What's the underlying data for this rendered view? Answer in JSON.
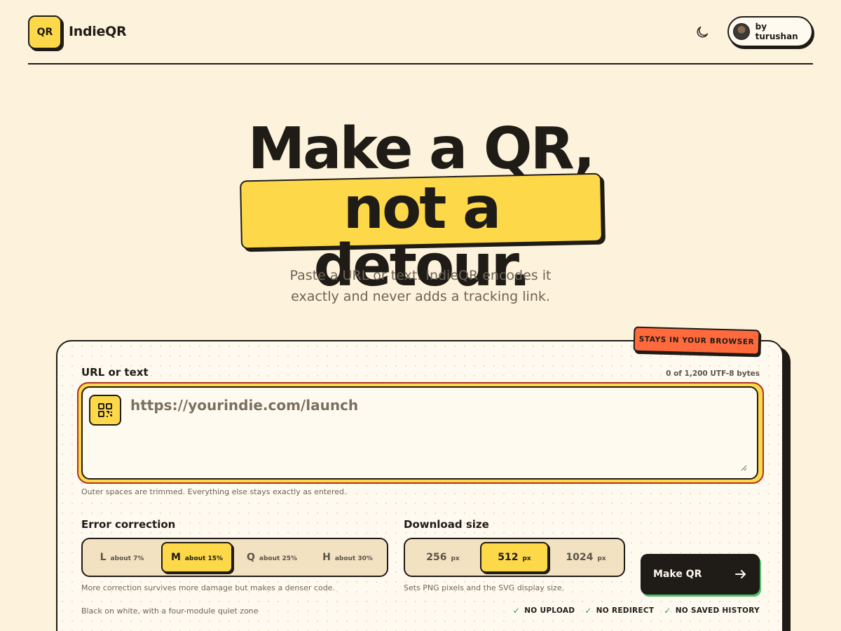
{
  "header": {
    "logo_text": "QR",
    "brand": "IndieQR",
    "author_label": "by turushan",
    "theme_icon": "moon-icon"
  },
  "hero": {
    "line1": "Make a QR,",
    "line2": "not a detour.",
    "subtitle_line1": "Paste a URL or text. IndieQR encodes it",
    "subtitle_line2": "exactly and never adds a tracking link."
  },
  "form": {
    "badge": "STAYS IN YOUR BROWSER",
    "input_label": "URL or text",
    "byte_count": "0 of 1,200 UTF-8 bytes",
    "input_value": "",
    "input_placeholder": "https://yourindie.com/launch",
    "input_hint": "Outer spaces are trimmed. Everything else stays exactly as entered.",
    "error_correction": {
      "label": "Error correction",
      "options": [
        {
          "level": "L",
          "detail": "about 7%"
        },
        {
          "level": "M",
          "detail": "about 15%"
        },
        {
          "level": "Q",
          "detail": "about 25%"
        },
        {
          "level": "H",
          "detail": "about 30%"
        }
      ],
      "selected": "M",
      "hint": "More correction survives more damage but makes a denser code."
    },
    "download_size": {
      "label": "Download size",
      "options": [
        {
          "value": "256",
          "unit": "px"
        },
        {
          "value": "512",
          "unit": "px"
        },
        {
          "value": "1024",
          "unit": "px"
        }
      ],
      "selected": "512",
      "hint": "Sets PNG pixels and the SVG display size."
    },
    "style_note": "Black on white, with a four-module quiet zone",
    "submit_label": "Make QR",
    "guarantees": [
      "NO UPLOAD",
      "NO REDIRECT",
      "NO SAVED HISTORY"
    ]
  },
  "colors": {
    "background": "#fdf3dc",
    "accent_yellow": "#fdd94a",
    "badge_orange": "#ff6a3d",
    "ink": "#1f1b16",
    "check_green": "#3a9a55"
  }
}
